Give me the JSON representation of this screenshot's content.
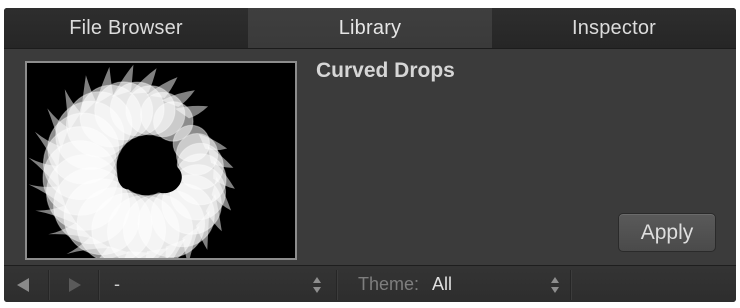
{
  "tabs": [
    {
      "label": "File Browser",
      "active": false
    },
    {
      "label": "Library",
      "active": true
    },
    {
      "label": "Inspector",
      "active": false
    }
  ],
  "preview": {
    "title": "Curved Drops",
    "thumbnail_icon": "curved-drops-preview",
    "apply_label": "Apply"
  },
  "footer": {
    "back_icon": "triangle-left-icon",
    "forward_icon": "triangle-right-icon",
    "path_value": "-",
    "theme_label": "Theme:",
    "theme_value": "All"
  },
  "colors": {
    "panel_bg": "#3b3b3b",
    "tab_bg": "#2a2a2a",
    "tab_active_bg": "#3d3d3d",
    "text": "#dcdcdc",
    "muted_text": "#7e7e7e"
  }
}
